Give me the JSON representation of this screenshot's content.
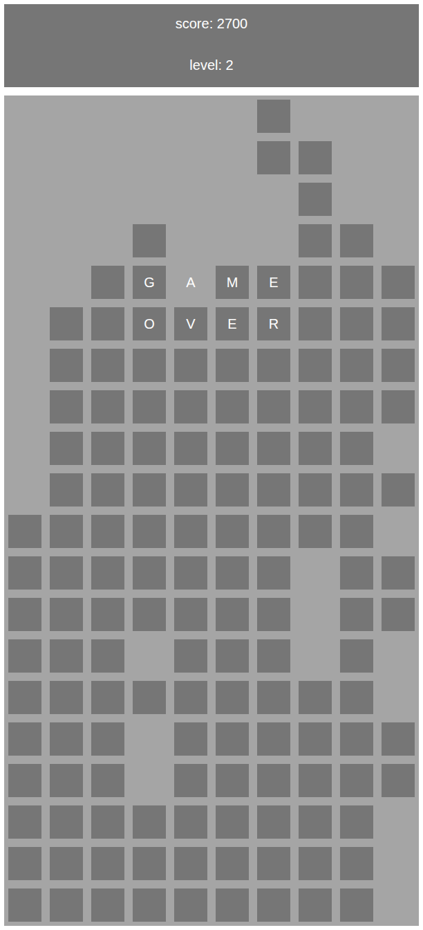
{
  "header": {
    "score": "score: 2700",
    "level": "level: 2"
  },
  "board": {
    "rows": [
      [
        false,
        false,
        false,
        false,
        false,
        false,
        true,
        false,
        false,
        false
      ],
      [
        false,
        false,
        false,
        false,
        false,
        false,
        true,
        true,
        false,
        false
      ],
      [
        false,
        false,
        false,
        false,
        false,
        false,
        false,
        true,
        false,
        false
      ],
      [
        false,
        false,
        false,
        true,
        false,
        false,
        false,
        true,
        true,
        false
      ],
      [
        false,
        false,
        true,
        true,
        false,
        true,
        true,
        true,
        true,
        true
      ],
      [
        false,
        true,
        true,
        true,
        true,
        true,
        true,
        true,
        true,
        true
      ],
      [
        false,
        true,
        true,
        true,
        true,
        true,
        true,
        true,
        true,
        true
      ],
      [
        false,
        true,
        true,
        true,
        true,
        true,
        true,
        true,
        true,
        true
      ],
      [
        false,
        true,
        true,
        true,
        true,
        true,
        true,
        true,
        true,
        false
      ],
      [
        false,
        true,
        true,
        true,
        true,
        true,
        true,
        true,
        true,
        true
      ],
      [
        true,
        true,
        true,
        true,
        true,
        true,
        true,
        true,
        true,
        false
      ],
      [
        true,
        true,
        true,
        true,
        true,
        true,
        true,
        false,
        true,
        true
      ],
      [
        true,
        true,
        true,
        true,
        true,
        true,
        true,
        false,
        true,
        true
      ],
      [
        true,
        true,
        true,
        false,
        true,
        true,
        true,
        false,
        true,
        false
      ],
      [
        true,
        true,
        true,
        true,
        true,
        true,
        true,
        true,
        true,
        false
      ],
      [
        true,
        true,
        true,
        false,
        true,
        true,
        true,
        true,
        true,
        true
      ],
      [
        true,
        true,
        true,
        false,
        true,
        true,
        true,
        true,
        true,
        true
      ],
      [
        true,
        true,
        true,
        true,
        true,
        true,
        true,
        true,
        true,
        false
      ],
      [
        true,
        true,
        true,
        true,
        true,
        true,
        true,
        true,
        true,
        false
      ],
      [
        true,
        true,
        true,
        true,
        true,
        true,
        true,
        true,
        true,
        false
      ]
    ]
  },
  "game_over": {
    "letters": [
      [
        "G",
        "A",
        "M",
        "E"
      ],
      [
        "O",
        "V",
        "E",
        "R"
      ]
    ]
  }
}
